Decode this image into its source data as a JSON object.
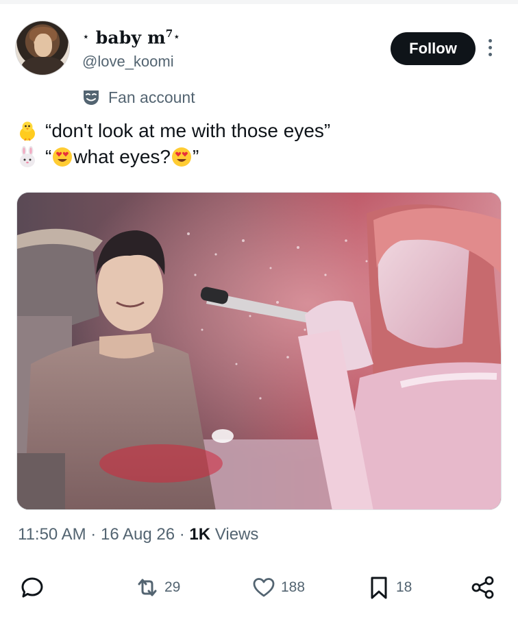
{
  "account": {
    "display_name_prefix": "⋆",
    "display_name": "baby m",
    "display_name_sup": "7",
    "display_name_suffix": "⋆",
    "handle": "@love_koomi",
    "label": "Fan account",
    "avatar_icon": "profile-photo"
  },
  "header": {
    "follow_label": "Follow",
    "more_icon": "more-vertical-icon"
  },
  "tweet": {
    "line1_emoji": "🐥",
    "line1_text": "“don't look at me with those eyes”",
    "line2_emoji": "🐰",
    "line2_open": "“",
    "line2_text": "what eyes?",
    "line2_close": "”",
    "inline_emoji": "😍"
  },
  "media": {
    "description_icon": "concert-photo"
  },
  "meta": {
    "time": "11:50 AM",
    "separator": "·",
    "date": "16 Aug 26",
    "views_count": "1K",
    "views_label": "Views"
  },
  "actions": {
    "reply_icon": "reply-icon",
    "retweet_count": "29",
    "like_count": "188",
    "bookmark_count": "18",
    "share_icon": "share-icon"
  },
  "colors": {
    "text_primary": "#0f1419",
    "text_secondary": "#536471",
    "follow_bg": "#0f1419"
  }
}
